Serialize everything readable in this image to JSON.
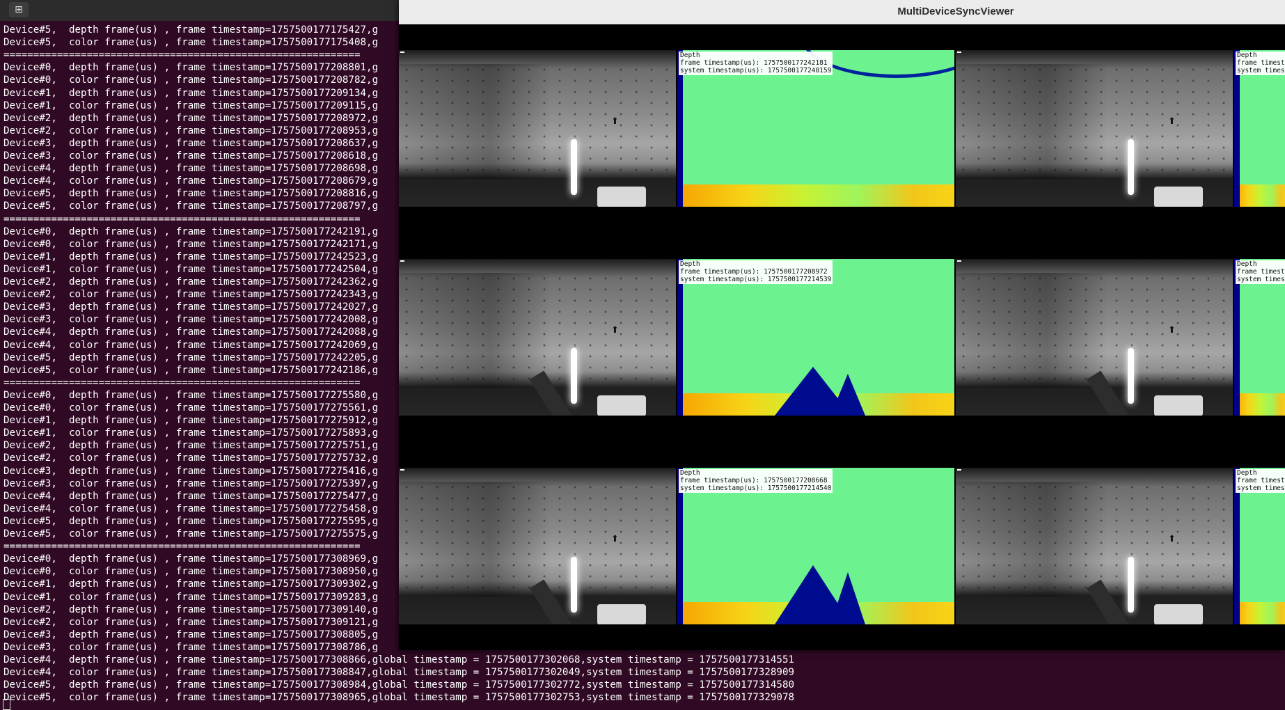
{
  "topbar": {
    "new_tab_icon": "⊞"
  },
  "terminal": {
    "lines": [
      "Device#5,  depth frame(us) , frame timestamp=1757500177175427,g",
      "Device#5,  color frame(us) , frame timestamp=1757500177175408,g",
      "============================================================",
      "Device#0,  depth frame(us) , frame timestamp=1757500177208801,g",
      "Device#0,  color frame(us) , frame timestamp=1757500177208782,g",
      "Device#1,  depth frame(us) , frame timestamp=1757500177209134,g",
      "Device#1,  color frame(us) , frame timestamp=1757500177209115,g",
      "Device#2,  depth frame(us) , frame timestamp=1757500177208972,g",
      "Device#2,  color frame(us) , frame timestamp=1757500177208953,g",
      "Device#3,  depth frame(us) , frame timestamp=1757500177208637,g",
      "Device#3,  color frame(us) , frame timestamp=1757500177208618,g",
      "Device#4,  depth frame(us) , frame timestamp=1757500177208698,g",
      "Device#4,  color frame(us) , frame timestamp=1757500177208679,g",
      "Device#5,  depth frame(us) , frame timestamp=1757500177208816,g",
      "Device#5,  color frame(us) , frame timestamp=1757500177208797,g",
      "============================================================",
      "Device#0,  depth frame(us) , frame timestamp=1757500177242191,g",
      "Device#0,  color frame(us) , frame timestamp=1757500177242171,g",
      "Device#1,  depth frame(us) , frame timestamp=1757500177242523,g",
      "Device#1,  color frame(us) , frame timestamp=1757500177242504,g",
      "Device#2,  depth frame(us) , frame timestamp=1757500177242362,g",
      "Device#2,  color frame(us) , frame timestamp=1757500177242343,g",
      "Device#3,  depth frame(us) , frame timestamp=1757500177242027,g",
      "Device#3,  color frame(us) , frame timestamp=1757500177242008,g",
      "Device#4,  depth frame(us) , frame timestamp=1757500177242088,g",
      "Device#4,  color frame(us) , frame timestamp=1757500177242069,g",
      "Device#5,  depth frame(us) , frame timestamp=1757500177242205,g",
      "Device#5,  color frame(us) , frame timestamp=1757500177242186,g",
      "============================================================",
      "Device#0,  depth frame(us) , frame timestamp=1757500177275580,g",
      "Device#0,  color frame(us) , frame timestamp=1757500177275561,g",
      "Device#1,  depth frame(us) , frame timestamp=1757500177275912,g",
      "Device#1,  color frame(us) , frame timestamp=1757500177275893,g",
      "Device#2,  depth frame(us) , frame timestamp=1757500177275751,g",
      "Device#2,  color frame(us) , frame timestamp=1757500177275732,g",
      "Device#3,  depth frame(us) , frame timestamp=1757500177275416,g",
      "Device#3,  color frame(us) , frame timestamp=1757500177275397,g",
      "Device#4,  depth frame(us) , frame timestamp=1757500177275477,g",
      "Device#4,  color frame(us) , frame timestamp=1757500177275458,g",
      "Device#5,  depth frame(us) , frame timestamp=1757500177275595,g",
      "Device#5,  color frame(us) , frame timestamp=1757500177275575,g",
      "============================================================",
      "Device#0,  depth frame(us) , frame timestamp=1757500177308969,g",
      "Device#0,  color frame(us) , frame timestamp=1757500177308950,g",
      "Device#1,  depth frame(us) , frame timestamp=1757500177309302,g",
      "Device#1,  color frame(us) , frame timestamp=1757500177309283,g",
      "Device#2,  depth frame(us) , frame timestamp=1757500177309140,g",
      "Device#2,  color frame(us) , frame timestamp=1757500177309121,g",
      "Device#3,  depth frame(us) , frame timestamp=1757500177308805,g",
      "Device#3,  color frame(us) , frame timestamp=1757500177308786,g",
      "Device#4,  depth frame(us) , frame timestamp=1757500177308866,global timestamp = 1757500177302068,system timestamp = 1757500177314551",
      "Device#4,  color frame(us) , frame timestamp=1757500177308847,global timestamp = 1757500177302049,system timestamp = 1757500177328909",
      "Device#5,  depth frame(us) , frame timestamp=1757500177308984,global timestamp = 1757500177302772,system timestamp = 1757500177314580",
      "Device#5,  color frame(us) , frame timestamp=1757500177308965,global timestamp = 1757500177302753,system timestamp = 1757500177329078"
    ]
  },
  "viewer": {
    "title": "MultiDeviceSyncViewer",
    "depth_overlays": [
      [
        "Depth",
        "frame timestamp(us): 1757500177242181",
        "system timestamp(us): 1757500177248159"
      ],
      [
        "Depth",
        "frame timestamp(us): 1757500177208972",
        "system timestamp(us): 1757500177214539"
      ],
      [
        "Depth",
        "frame timestamp(us): 1757500177208668",
        "system timestamp(us): 1757500177214540"
      ]
    ],
    "partial_overlay": [
      "Depth",
      "frame timestam",
      "system timesta"
    ]
  }
}
